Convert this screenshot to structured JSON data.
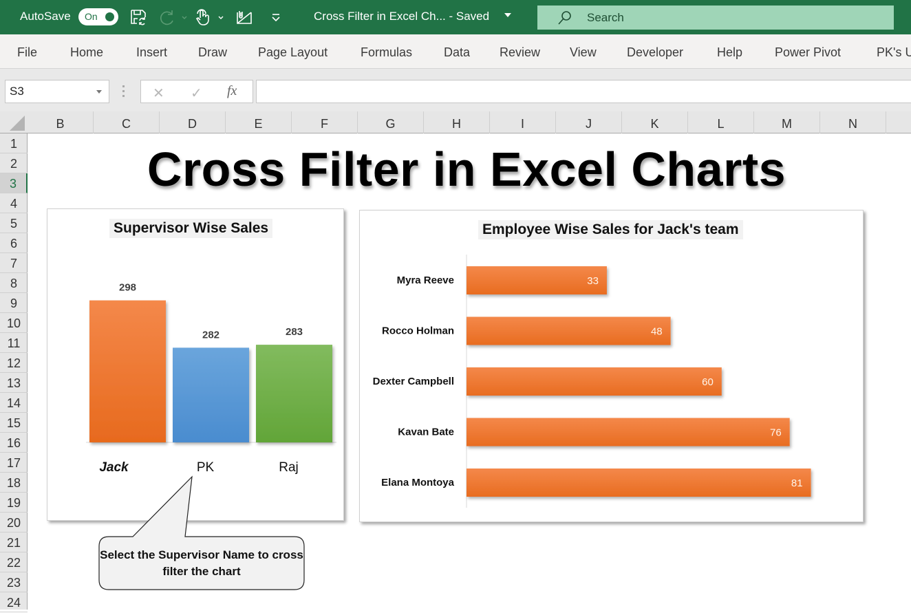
{
  "titlebar": {
    "autosave_label": "AutoSave",
    "autosave_state": "On",
    "document_title": "Cross Filter in Excel Ch...  -  Saved",
    "search_placeholder": "Search",
    "icons": [
      "save-sync-icon",
      "redo-icon",
      "touch-mode-icon",
      "send-email-icon",
      "customize-toolbar-icon"
    ]
  },
  "menu": {
    "items": [
      "File",
      "Home",
      "Insert",
      "Draw",
      "Page Layout",
      "Formulas",
      "Data",
      "Review",
      "View",
      "Developer",
      "Help",
      "Power Pivot",
      "PK's U"
    ]
  },
  "formula_bar": {
    "name_box": "S3",
    "cancel": "✕",
    "enter": "✓",
    "fx": "fx",
    "formula": ""
  },
  "grid": {
    "columns": [
      "B",
      "C",
      "D",
      "E",
      "F",
      "G",
      "H",
      "I",
      "J",
      "K",
      "L",
      "M",
      "N"
    ],
    "rows": [
      "1",
      "2",
      "3",
      "4",
      "5",
      "6",
      "7",
      "8",
      "9",
      "10",
      "11",
      "12",
      "13",
      "14",
      "15",
      "16",
      "17",
      "18",
      "19",
      "20",
      "21",
      "22",
      "23",
      "24"
    ],
    "selected_row": "3"
  },
  "sheet": {
    "title": "Cross Filter in Excel Charts",
    "callout": "Select the Supervisor Name to cross filter the chart"
  },
  "chart_data": [
    {
      "type": "bar",
      "title": "Supervisor Wise Sales",
      "categories": [
        "Jack",
        "PK",
        "Raj"
      ],
      "values": [
        298,
        282,
        283
      ],
      "colors": [
        "#ed7d31",
        "#5b9bd5",
        "#70ad47"
      ],
      "selected_category": "Jack",
      "ylim": [
        250,
        300
      ],
      "xlabel": "",
      "ylabel": "",
      "grid": false,
      "data_labels": true
    },
    {
      "type": "bar",
      "orientation": "horizontal",
      "title": "Employee Wise Sales for Jack's team",
      "categories": [
        "Myra Reeve",
        "Rocco Holman",
        "Dexter Campbell",
        "Kavan Bate",
        "Elana Montoya"
      ],
      "values": [
        33,
        48,
        60,
        76,
        81
      ],
      "color": "#ed7d31",
      "xlim": [
        0,
        90
      ],
      "xlabel": "",
      "ylabel": "",
      "grid": false,
      "data_labels": true
    }
  ]
}
